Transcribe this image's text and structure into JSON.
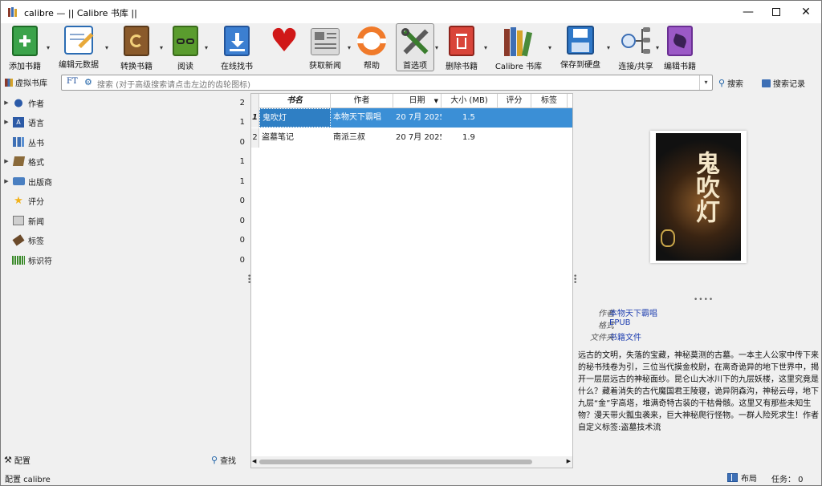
{
  "window": {
    "title": "calibre — || Calibre 书库 ||"
  },
  "toolbar": {
    "items": [
      {
        "label": "添加书籍",
        "icon": "add-book-icon"
      },
      {
        "label": "编辑元数据",
        "icon": "edit-metadata-icon"
      },
      {
        "label": "转换书籍",
        "icon": "convert-books-icon"
      },
      {
        "label": "阅读",
        "icon": "read-book-icon"
      },
      {
        "label": "在线找书",
        "icon": "get-books-icon"
      },
      {
        "label": "",
        "icon": "donate-heart-icon"
      },
      {
        "label": "获取新闻",
        "icon": "fetch-news-icon"
      },
      {
        "label": "帮助",
        "icon": "help-icon"
      },
      {
        "label": "首选项",
        "icon": "preferences-icon"
      },
      {
        "label": "删除书籍",
        "icon": "remove-books-icon"
      },
      {
        "label": "Calibre 书库",
        "icon": "library-icon"
      },
      {
        "label": "保存到硬盘",
        "icon": "save-to-disk-icon"
      },
      {
        "label": "连接/共享",
        "icon": "connect-share-icon"
      },
      {
        "label": "编辑书籍",
        "icon": "edit-book-icon"
      }
    ]
  },
  "search": {
    "virtual_library": "虚拟书库",
    "placeholder": "搜索 (对于高级搜索请点击左边的齿轮图标)",
    "search_button": "搜索",
    "saved_searches": "搜索记录",
    "ft_label": "FT"
  },
  "categories": [
    {
      "label": "作者",
      "count": "2",
      "expandable": true,
      "icon": "authors-icon"
    },
    {
      "label": "语言",
      "count": "1",
      "expandable": true,
      "icon": "languages-icon"
    },
    {
      "label": "丛书",
      "count": "0",
      "expandable": false,
      "icon": "series-icon"
    },
    {
      "label": "格式",
      "count": "1",
      "expandable": true,
      "icon": "formats-icon"
    },
    {
      "label": "出版商",
      "count": "1",
      "expandable": true,
      "icon": "publisher-icon"
    },
    {
      "label": "评分",
      "count": "0",
      "expandable": false,
      "icon": "rating-icon"
    },
    {
      "label": "新闻",
      "count": "0",
      "expandable": false,
      "icon": "news-icon"
    },
    {
      "label": "标签",
      "count": "0",
      "expandable": false,
      "icon": "tags-icon"
    },
    {
      "label": "标识符",
      "count": "0",
      "expandable": false,
      "icon": "identifiers-icon"
    }
  ],
  "left_bottom": {
    "configure": "配置",
    "find": "查找"
  },
  "table": {
    "columns": [
      "书名",
      "作者",
      "日期",
      "大小 (MB)",
      "评分",
      "标签"
    ],
    "rows": [
      {
        "num": "1",
        "title": "鬼吹灯",
        "author": "本物天下霸唱",
        "date": "20 7月 2025",
        "size": "1.5",
        "selected": true
      },
      {
        "num": "2",
        "title": "盗墓笔记",
        "author": "南派三叔",
        "date": "20 7月 2025",
        "size": "1.9",
        "selected": false
      }
    ]
  },
  "details": {
    "meta": [
      {
        "key": "作者",
        "value": "本物天下霸唱"
      },
      {
        "key": "格式",
        "value": "EPUB"
      },
      {
        "key": "文件夹",
        "value": "书籍文件"
      }
    ],
    "description": "远古的文明，失落的宝藏，神秘莫测的古墓。一本主人公家中传下来的秘书残卷为引，三位当代摸金校尉，在离奇诡异的地下世界中，揭开一层层远古的神秘面纱。昆仑山大冰川下的九层妖楼，这里究竟是什么？藏着消失的古代魔国君王陵寝，诡异阴森沟，神秘云母，地下九层“金”字高塔，堆满奇特古装的干枯骨骸。这里又有那些未知生物？漫天带火瓢虫袭来，巨大神秘爬行怪物。一群人险死求生！作者自定义标签:盗墓技术流",
    "cover_title": "鬼吹灯"
  },
  "status": {
    "left": "配置 calibre",
    "layout": "布局",
    "jobs": "任务： 0"
  },
  "colors": {
    "selection": "#3b8fd6",
    "link": "#1f3fb0"
  }
}
